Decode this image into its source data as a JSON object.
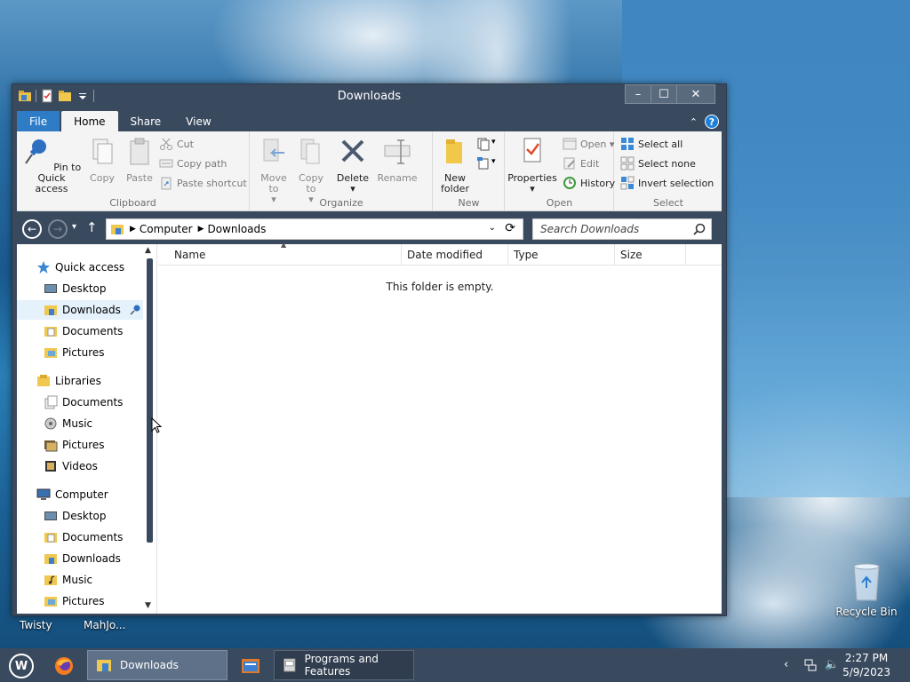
{
  "window": {
    "title": "Downloads",
    "controls": {
      "minimize": "–",
      "maximize": "☐",
      "close": "✕"
    }
  },
  "tabs": [
    {
      "label": "File"
    },
    {
      "label": "Home"
    },
    {
      "label": "Share"
    },
    {
      "label": "View"
    }
  ],
  "ribbon": {
    "clipboard": {
      "label": "Clipboard",
      "pin": "Pin to Quick access",
      "copy": "Copy",
      "paste": "Paste",
      "cut": "Cut",
      "copy_path": "Copy path",
      "paste_shortcut": "Paste shortcut"
    },
    "organize": {
      "label": "Organize",
      "move_to": "Move to",
      "copy_to": "Copy to",
      "delete": "Delete",
      "rename": "Rename"
    },
    "new": {
      "label": "New",
      "new_folder": "New folder"
    },
    "open": {
      "label": "Open",
      "properties": "Properties",
      "open": "Open",
      "edit": "Edit",
      "history": "History"
    },
    "select": {
      "label": "Select",
      "select_all": "Select all",
      "select_none": "Select none",
      "invert": "Invert selection"
    }
  },
  "address": {
    "crumbs": [
      "Computer",
      "Downloads"
    ],
    "search_placeholder": "Search Downloads"
  },
  "nav": {
    "quick_access": "Quick access",
    "quick_items": [
      "Desktop",
      "Downloads",
      "Documents",
      "Pictures"
    ],
    "libraries": "Libraries",
    "library_items": [
      "Documents",
      "Music",
      "Pictures",
      "Videos"
    ],
    "computer": "Computer",
    "computer_items": [
      "Desktop",
      "Documents",
      "Downloads",
      "Music",
      "Pictures"
    ]
  },
  "columns": [
    "Name",
    "Date modified",
    "Type",
    "Size"
  ],
  "empty_message": "This folder is empty.",
  "desktop": {
    "icons": [
      "Twisty",
      "MahJo...",
      "Recycle Bin"
    ]
  },
  "taskbar": {
    "start": "W",
    "buttons": [
      "Downloads",
      "Programs and Features"
    ],
    "time": "2:27 PM",
    "date": "5/9/2023"
  }
}
